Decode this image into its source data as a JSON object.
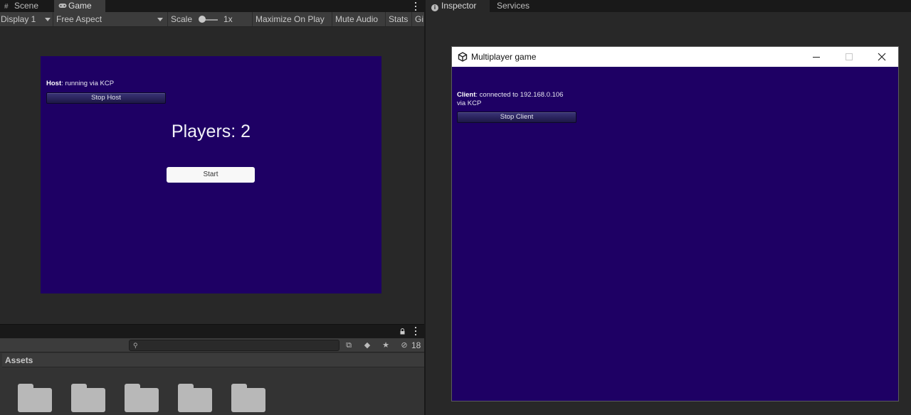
{
  "editor": {
    "tabs": [
      {
        "label": "Scene",
        "icon": "grid-icon"
      },
      {
        "label": "Game",
        "icon": "gamepad-icon"
      }
    ],
    "toolbar": {
      "display": "Display 1",
      "aspect": "Free Aspect",
      "scale_label": "Scale",
      "scale_value": "1x",
      "maximize": "Maximize On Play",
      "mute": "Mute Audio",
      "stats": "Stats",
      "gizmos": "Gi"
    },
    "game": {
      "host_label": "Host",
      "host_status": ": running via KCP",
      "stop_host": "Stop Host",
      "players_text": "Players: 2",
      "start": "Start"
    },
    "project": {
      "search_placeholder": "",
      "hidden_count": "18",
      "assets_header": "Assets",
      "folder_count": 5
    }
  },
  "inspector": {
    "tabs": [
      {
        "label": "Inspector",
        "icon": "info-icon"
      },
      {
        "label": "Services"
      }
    ]
  },
  "player_window": {
    "title": "Multiplayer game",
    "client_label": "Client",
    "client_status_line1": ": connected to 192.168.0.106",
    "client_status_line2": "via KCP",
    "stop_client": "Stop Client",
    "controls": {
      "minimize": "─",
      "maximize": "□",
      "close": "✕"
    }
  },
  "colors": {
    "game_background": "#1e0064",
    "editor_dark": "#191919",
    "editor_panel": "#282828",
    "toolbar": "#3c3c3c"
  }
}
